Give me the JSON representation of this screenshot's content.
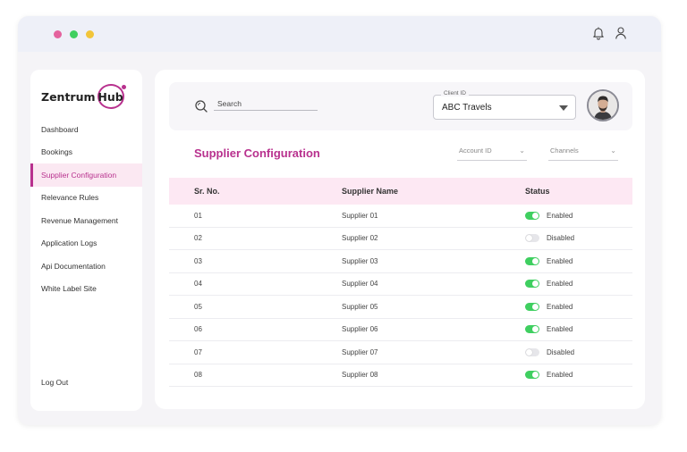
{
  "app": {
    "logo_text": "Zentrum",
    "logo_hub": "Hub"
  },
  "sidebar": {
    "items": [
      {
        "label": "Dashboard"
      },
      {
        "label": "Bookings"
      },
      {
        "label": "Supplier Configuration"
      },
      {
        "label": "Relevance Rules"
      },
      {
        "label": "Revenue Management"
      },
      {
        "label": "Application Logs"
      },
      {
        "label": "Api Documentation"
      },
      {
        "label": "White Label Site"
      }
    ],
    "active_item": "Supplier Configuration",
    "logout_label": "Log Out"
  },
  "topbar": {
    "search_placeholder": "Search",
    "client_label": "Client ID",
    "client_value": "ABC Travels"
  },
  "page": {
    "title": "Supplier Configuration",
    "filter_account": "Account ID",
    "filter_channels": "Channels"
  },
  "table": {
    "headers": {
      "sr": "Sr. No.",
      "name": "Supplier Name",
      "status": "Status"
    },
    "rows": [
      {
        "sr": "01",
        "name": "Supplier 01",
        "status": "Enabled",
        "on": true
      },
      {
        "sr": "02",
        "name": "Supplier 02",
        "status": "Disabled",
        "on": false
      },
      {
        "sr": "03",
        "name": "Supplier 03",
        "status": "Enabled",
        "on": true
      },
      {
        "sr": "04",
        "name": "Supplier 04",
        "status": "Enabled",
        "on": true
      },
      {
        "sr": "05",
        "name": "Supplier 05",
        "status": "Enabled",
        "on": true
      },
      {
        "sr": "06",
        "name": "Supplier 06",
        "status": "Enabled",
        "on": true
      },
      {
        "sr": "07",
        "name": "Supplier 07",
        "status": "Disabled",
        "on": false
      },
      {
        "sr": "08",
        "name": "Supplier 08",
        "status": "Enabled",
        "on": true
      }
    ]
  },
  "colors": {
    "accent": "#b8318e",
    "header_bg": "#fde8f3",
    "toggle_on": "#3fcf60",
    "toggle_off": "#e6e6ea"
  }
}
